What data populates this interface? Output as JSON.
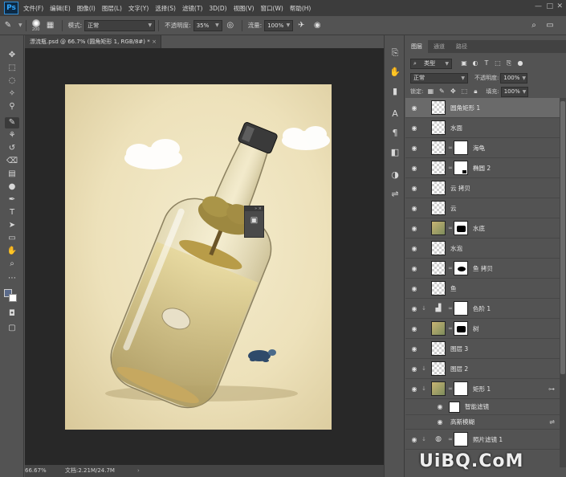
{
  "app": {
    "logo": "Ps"
  },
  "menu": [
    "文件(F)",
    "编辑(E)",
    "图像(I)",
    "图层(L)",
    "文字(Y)",
    "选择(S)",
    "滤镜(T)",
    "3D(D)",
    "视图(V)",
    "窗口(W)",
    "帮助(H)"
  ],
  "options": {
    "brush_size": "200",
    "mode_label": "模式:",
    "mode_value": "正常",
    "opacity_label": "不透明度:",
    "opacity_value": "35%",
    "flow_label": "流量:",
    "flow_value": "100%"
  },
  "document": {
    "tab_title": "漂流瓶.psd @ 66.7% (圆角矩形 1, RGB/8#) *",
    "zoom": "66.67%",
    "doc_info": "文档:2.21M/24.7M"
  },
  "layers_panel": {
    "tabs": [
      "图层",
      "通道",
      "路径"
    ],
    "filter_kind": "类型",
    "blend_mode": "正常",
    "opacity_label": "不透明度:",
    "opacity_value": "100%",
    "lock_label": "锁定:",
    "fill_label": "填充:",
    "fill_value": "100%",
    "layers": [
      {
        "name": "圆角矩形 1"
      },
      {
        "name": "水面"
      },
      {
        "name": "海龟"
      },
      {
        "name": "椭圆 2"
      },
      {
        "name": "云 拷贝"
      },
      {
        "name": "云"
      },
      {
        "name": "水底"
      },
      {
        "name": "水泡"
      },
      {
        "name": "鱼 拷贝"
      },
      {
        "name": "鱼"
      },
      {
        "name": "色阶 1"
      },
      {
        "name": "树"
      },
      {
        "name": "图层 3"
      },
      {
        "name": "图层 2"
      },
      {
        "name": "矩形 1"
      },
      {
        "name": "智能滤镜"
      },
      {
        "name": "高斯模糊"
      },
      {
        "name": "照片滤镜 1"
      }
    ]
  },
  "watermark": "UiBQ.CoM",
  "colors": {
    "accent": "#31a8ff",
    "panel": "#535353",
    "canvas_bg": "#282828",
    "artboard": "#efe4bf"
  }
}
